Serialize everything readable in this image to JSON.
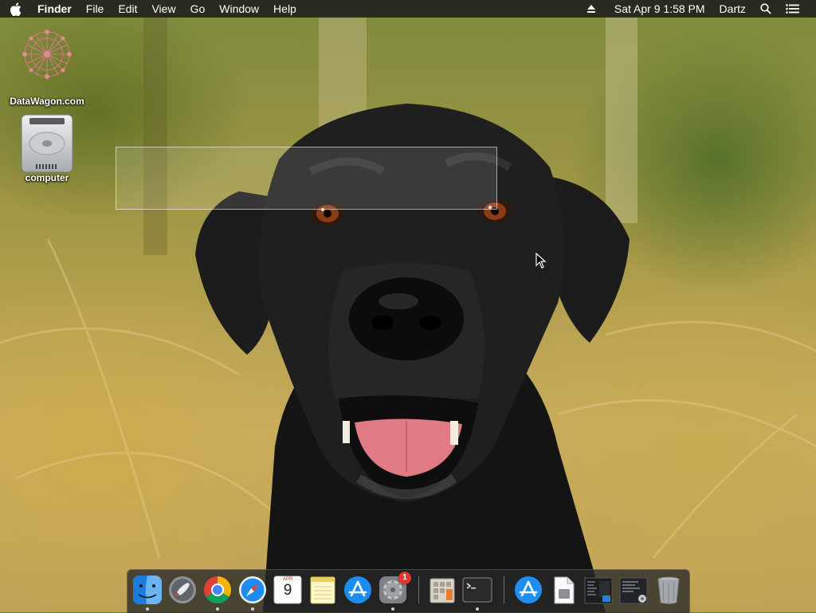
{
  "menubar": {
    "apple_icon": "apple-logo",
    "app_name": "Finder",
    "menus": [
      "File",
      "Edit",
      "View",
      "Go",
      "Window",
      "Help"
    ],
    "status": {
      "eject_icon": "eject-icon",
      "datetime": "Sat Apr 9  1:58 PM",
      "user": "Dartz",
      "search_icon": "spotlight-icon",
      "list_icon": "notification-center-icon"
    }
  },
  "desktop": {
    "icons": [
      {
        "label": "DataWagon.com",
        "icon": "datawagon-logo"
      },
      {
        "label": "computer",
        "icon": "hard-drive-icon"
      }
    ]
  },
  "dock": {
    "items": [
      {
        "name": "Finder",
        "icon": "finder-icon",
        "running": true
      },
      {
        "name": "Launchpad",
        "icon": "launchpad-icon",
        "running": false
      },
      {
        "name": "Google Chrome",
        "icon": "chrome-icon",
        "running": true
      },
      {
        "name": "Safari",
        "icon": "safari-icon",
        "running": true
      },
      {
        "name": "Calendar",
        "icon": "calendar-icon",
        "running": false,
        "month": "APR",
        "day": "9"
      },
      {
        "name": "Notes",
        "icon": "notes-icon",
        "running": false
      },
      {
        "name": "App Store",
        "icon": "app-store-icon",
        "running": false
      },
      {
        "name": "System Preferences",
        "icon": "system-preferences-icon",
        "running": true,
        "badge": "1"
      },
      {
        "name": "Script Editor",
        "icon": "script-editor-icon",
        "running": false
      },
      {
        "name": "Terminal",
        "icon": "terminal-icon",
        "running": true
      },
      {
        "name": "Applications",
        "icon": "applications-folder-icon",
        "running": false
      },
      {
        "name": "Document",
        "icon": "document-icon",
        "running": false
      },
      {
        "name": "Downloads",
        "icon": "downloads-stack-icon",
        "running": false
      },
      {
        "name": "Recent",
        "icon": "recent-stack-icon",
        "running": false
      },
      {
        "name": "Trash",
        "icon": "trash-icon",
        "running": false
      }
    ]
  },
  "colors": {
    "menubar_bg": "#1e1e1e",
    "badge_red": "#e5342b"
  }
}
